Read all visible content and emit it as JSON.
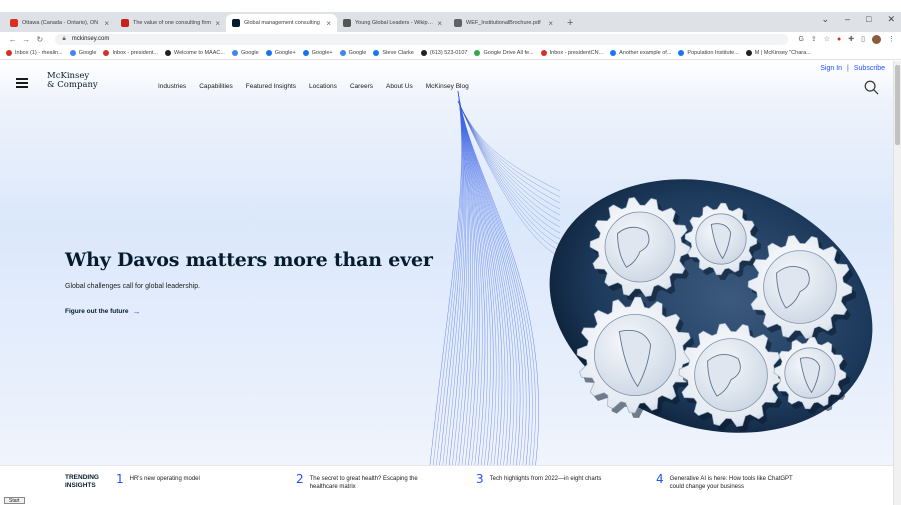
{
  "browser": {
    "tabs": [
      {
        "title": "Ottawa (Canada - Ontario), ON",
        "favicon_color": "#d93025"
      },
      {
        "title": "The value of one consulting firm",
        "favicon_color": "#c5221f"
      },
      {
        "title": "Global management consulting",
        "favicon_color": "#051c2c"
      },
      {
        "title": "Young Global Leaders - Wikipedi",
        "favicon_color": "#555555"
      },
      {
        "title": "WEF_InstitutionalBrochure.pdf",
        "favicon_color": "#5f6368"
      }
    ],
    "active_tab_index": 2,
    "address": "mckinsey.com",
    "bookmarks": [
      {
        "label": "Inbox (1) - rhealin...",
        "color": "#d93025"
      },
      {
        "label": "Google",
        "color": "#4285f4"
      },
      {
        "label": "Inbox - president...",
        "color": "#d93025"
      },
      {
        "label": "Welcome to MAAC...",
        "color": "#202124"
      },
      {
        "label": "Google",
        "color": "#4285f4"
      },
      {
        "label": "Google+",
        "color": "#1a73e8"
      },
      {
        "label": "Google+",
        "color": "#1a73e8"
      },
      {
        "label": "Google",
        "color": "#4285f4"
      },
      {
        "label": "Steve Clarke",
        "color": "#1877f2"
      },
      {
        "label": "(613) 523-0107",
        "color": "#202124"
      },
      {
        "label": "Google Drive All fe...",
        "color": "#34a853"
      },
      {
        "label": "Inbox - presidentCN...",
        "color": "#d93025"
      },
      {
        "label": "Another example of...",
        "color": "#1877f2"
      },
      {
        "label": "Population Institute...",
        "color": "#1877f2"
      },
      {
        "label": "M | McKinsey \"Chara...",
        "color": "#202124"
      }
    ]
  },
  "site": {
    "logo_line1": "McKinsey",
    "logo_line2": "& Company",
    "nav": [
      "Industries",
      "Capabilities",
      "Featured Insights",
      "Locations",
      "Careers",
      "About Us",
      "McKinsey Blog"
    ],
    "signin": "Sign In",
    "subscribe": "Subscribe",
    "separator": "|"
  },
  "hero": {
    "headline": "Why Davos matters more than ever",
    "subhead": "Global challenges call for global leadership.",
    "cta": "Figure out the future",
    "cta_arrow": "→"
  },
  "trending": {
    "title_line1": "TRENDING",
    "title_line2": "INSIGHTS",
    "items": [
      {
        "num": "1",
        "line1": "HR's new operating model",
        "line2": ""
      },
      {
        "num": "2",
        "line1": "The secret to great health? Escaping the",
        "line2": "healthcare matrix"
      },
      {
        "num": "3",
        "line1": "Tech highlights from 2022—in eight charts",
        "line2": ""
      },
      {
        "num": "4",
        "line1": "Generative AI is here: How tools like ChatGPT",
        "line2": "could change your business"
      }
    ]
  },
  "taskbar": {
    "start": "Start"
  },
  "colors": {
    "accent": "#2251ff",
    "navy": "#051c2c",
    "gear_body": "#1d3a5c"
  }
}
